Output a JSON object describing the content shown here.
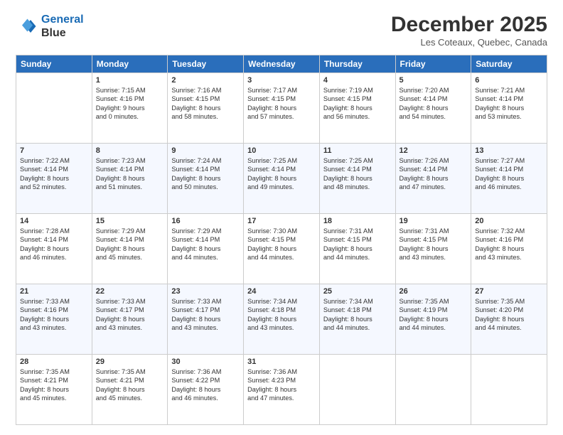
{
  "header": {
    "logo_line1": "General",
    "logo_line2": "Blue",
    "main_title": "December 2025",
    "sub_title": "Les Coteaux, Quebec, Canada"
  },
  "days_of_week": [
    "Sunday",
    "Monday",
    "Tuesday",
    "Wednesday",
    "Thursday",
    "Friday",
    "Saturday"
  ],
  "weeks": [
    [
      {
        "day": "",
        "lines": []
      },
      {
        "day": "1",
        "lines": [
          "Sunrise: 7:15 AM",
          "Sunset: 4:16 PM",
          "Daylight: 9 hours",
          "and 0 minutes."
        ]
      },
      {
        "day": "2",
        "lines": [
          "Sunrise: 7:16 AM",
          "Sunset: 4:15 PM",
          "Daylight: 8 hours",
          "and 58 minutes."
        ]
      },
      {
        "day": "3",
        "lines": [
          "Sunrise: 7:17 AM",
          "Sunset: 4:15 PM",
          "Daylight: 8 hours",
          "and 57 minutes."
        ]
      },
      {
        "day": "4",
        "lines": [
          "Sunrise: 7:19 AM",
          "Sunset: 4:15 PM",
          "Daylight: 8 hours",
          "and 56 minutes."
        ]
      },
      {
        "day": "5",
        "lines": [
          "Sunrise: 7:20 AM",
          "Sunset: 4:14 PM",
          "Daylight: 8 hours",
          "and 54 minutes."
        ]
      },
      {
        "day": "6",
        "lines": [
          "Sunrise: 7:21 AM",
          "Sunset: 4:14 PM",
          "Daylight: 8 hours",
          "and 53 minutes."
        ]
      }
    ],
    [
      {
        "day": "7",
        "lines": [
          "Sunrise: 7:22 AM",
          "Sunset: 4:14 PM",
          "Daylight: 8 hours",
          "and 52 minutes."
        ]
      },
      {
        "day": "8",
        "lines": [
          "Sunrise: 7:23 AM",
          "Sunset: 4:14 PM",
          "Daylight: 8 hours",
          "and 51 minutes."
        ]
      },
      {
        "day": "9",
        "lines": [
          "Sunrise: 7:24 AM",
          "Sunset: 4:14 PM",
          "Daylight: 8 hours",
          "and 50 minutes."
        ]
      },
      {
        "day": "10",
        "lines": [
          "Sunrise: 7:25 AM",
          "Sunset: 4:14 PM",
          "Daylight: 8 hours",
          "and 49 minutes."
        ]
      },
      {
        "day": "11",
        "lines": [
          "Sunrise: 7:25 AM",
          "Sunset: 4:14 PM",
          "Daylight: 8 hours",
          "and 48 minutes."
        ]
      },
      {
        "day": "12",
        "lines": [
          "Sunrise: 7:26 AM",
          "Sunset: 4:14 PM",
          "Daylight: 8 hours",
          "and 47 minutes."
        ]
      },
      {
        "day": "13",
        "lines": [
          "Sunrise: 7:27 AM",
          "Sunset: 4:14 PM",
          "Daylight: 8 hours",
          "and 46 minutes."
        ]
      }
    ],
    [
      {
        "day": "14",
        "lines": [
          "Sunrise: 7:28 AM",
          "Sunset: 4:14 PM",
          "Daylight: 8 hours",
          "and 46 minutes."
        ]
      },
      {
        "day": "15",
        "lines": [
          "Sunrise: 7:29 AM",
          "Sunset: 4:14 PM",
          "Daylight: 8 hours",
          "and 45 minutes."
        ]
      },
      {
        "day": "16",
        "lines": [
          "Sunrise: 7:29 AM",
          "Sunset: 4:14 PM",
          "Daylight: 8 hours",
          "and 44 minutes."
        ]
      },
      {
        "day": "17",
        "lines": [
          "Sunrise: 7:30 AM",
          "Sunset: 4:15 PM",
          "Daylight: 8 hours",
          "and 44 minutes."
        ]
      },
      {
        "day": "18",
        "lines": [
          "Sunrise: 7:31 AM",
          "Sunset: 4:15 PM",
          "Daylight: 8 hours",
          "and 44 minutes."
        ]
      },
      {
        "day": "19",
        "lines": [
          "Sunrise: 7:31 AM",
          "Sunset: 4:15 PM",
          "Daylight: 8 hours",
          "and 43 minutes."
        ]
      },
      {
        "day": "20",
        "lines": [
          "Sunrise: 7:32 AM",
          "Sunset: 4:16 PM",
          "Daylight: 8 hours",
          "and 43 minutes."
        ]
      }
    ],
    [
      {
        "day": "21",
        "lines": [
          "Sunrise: 7:33 AM",
          "Sunset: 4:16 PM",
          "Daylight: 8 hours",
          "and 43 minutes."
        ]
      },
      {
        "day": "22",
        "lines": [
          "Sunrise: 7:33 AM",
          "Sunset: 4:17 PM",
          "Daylight: 8 hours",
          "and 43 minutes."
        ]
      },
      {
        "day": "23",
        "lines": [
          "Sunrise: 7:33 AM",
          "Sunset: 4:17 PM",
          "Daylight: 8 hours",
          "and 43 minutes."
        ]
      },
      {
        "day": "24",
        "lines": [
          "Sunrise: 7:34 AM",
          "Sunset: 4:18 PM",
          "Daylight: 8 hours",
          "and 43 minutes."
        ]
      },
      {
        "day": "25",
        "lines": [
          "Sunrise: 7:34 AM",
          "Sunset: 4:18 PM",
          "Daylight: 8 hours",
          "and 44 minutes."
        ]
      },
      {
        "day": "26",
        "lines": [
          "Sunrise: 7:35 AM",
          "Sunset: 4:19 PM",
          "Daylight: 8 hours",
          "and 44 minutes."
        ]
      },
      {
        "day": "27",
        "lines": [
          "Sunrise: 7:35 AM",
          "Sunset: 4:20 PM",
          "Daylight: 8 hours",
          "and 44 minutes."
        ]
      }
    ],
    [
      {
        "day": "28",
        "lines": [
          "Sunrise: 7:35 AM",
          "Sunset: 4:21 PM",
          "Daylight: 8 hours",
          "and 45 minutes."
        ]
      },
      {
        "day": "29",
        "lines": [
          "Sunrise: 7:35 AM",
          "Sunset: 4:21 PM",
          "Daylight: 8 hours",
          "and 45 minutes."
        ]
      },
      {
        "day": "30",
        "lines": [
          "Sunrise: 7:36 AM",
          "Sunset: 4:22 PM",
          "Daylight: 8 hours",
          "and 46 minutes."
        ]
      },
      {
        "day": "31",
        "lines": [
          "Sunrise: 7:36 AM",
          "Sunset: 4:23 PM",
          "Daylight: 8 hours",
          "and 47 minutes."
        ]
      },
      {
        "day": "",
        "lines": []
      },
      {
        "day": "",
        "lines": []
      },
      {
        "day": "",
        "lines": []
      }
    ]
  ]
}
